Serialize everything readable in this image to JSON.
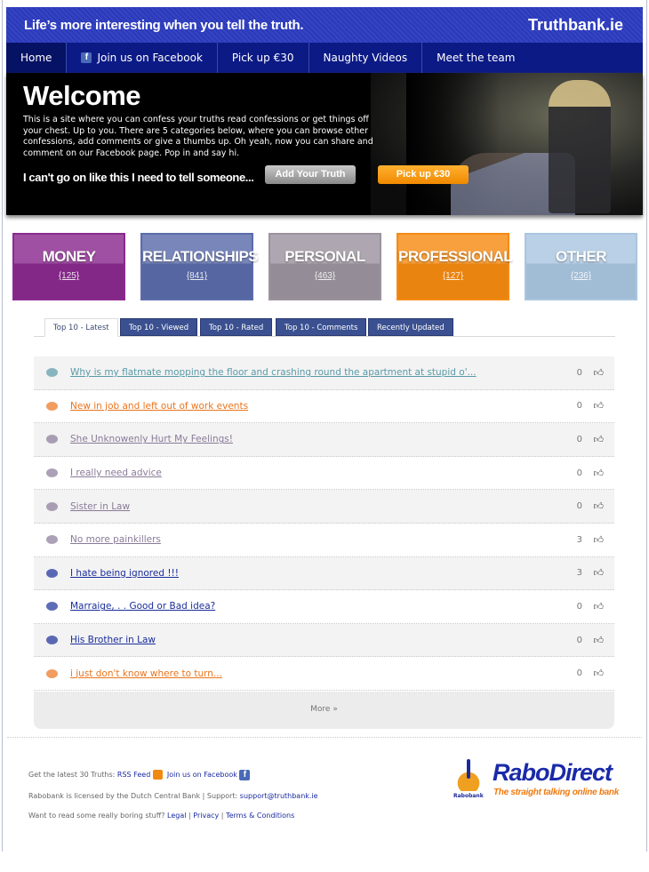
{
  "header": {
    "tagline": "Life’s more interesting when you tell the truth.",
    "brand": "Truthbank.ie"
  },
  "nav": {
    "items": [
      {
        "label": "Home"
      },
      {
        "label": "Join us on Facebook",
        "icon": "facebook-icon"
      },
      {
        "label": "Pick up €30"
      },
      {
        "label": "Naughty Videos"
      },
      {
        "label": "Meet the team"
      }
    ]
  },
  "hero": {
    "title": "Welcome",
    "text": "This is a site where you can confess your truths read confessions or get things off your chest. Up to you. There are 5 categories below, where you can browse other confessions, add comments or give a thumbs up. Oh yeah, now you can share and comment on our Facebook page. Pop in and say hi.",
    "cta": "I can't go on like this I need to tell someone...",
    "add_button": "Add Your Truth",
    "pick_button": "Pick up €30"
  },
  "categories": [
    {
      "name": "MONEY",
      "count": "{125}",
      "color": "#8a2a8e"
    },
    {
      "name": "RELATIONSHIPS",
      "count": "{841}",
      "color": "#5b6cab"
    },
    {
      "name": "PERSONAL",
      "count": "{463}",
      "color": "#9c939f"
    },
    {
      "name": "PROFESSIONAL",
      "count": "{127}",
      "color": "#f58b12"
    },
    {
      "name": "OTHER",
      "count": "{236}",
      "color": "#aac6e0"
    }
  ],
  "tabs": [
    {
      "label": "Top 10 - Latest",
      "active": true
    },
    {
      "label": "Top 10 - Viewed"
    },
    {
      "label": "Top 10 - Rated"
    },
    {
      "label": "Top 10 - Comments"
    },
    {
      "label": "Recently Updated"
    }
  ],
  "list": [
    {
      "title": "Why is my flatmate mopping the floor and crashing round the apartment at stupid o'...",
      "votes": "0",
      "color": "#5a9aa8"
    },
    {
      "title": "New in job and left out of work events",
      "votes": "0",
      "color": "#ea741c"
    },
    {
      "title": "She Unknowenly Hurt My Feelings!",
      "votes": "0",
      "color": "#8a7a98"
    },
    {
      "title": "I really need advice",
      "votes": "0",
      "color": "#8a7a98"
    },
    {
      "title": "Sister in Law",
      "votes": "0",
      "color": "#8a7a98"
    },
    {
      "title": "No more painkillers",
      "votes": "3",
      "color": "#8a7a98"
    },
    {
      "title": "I hate being ignored !!!",
      "votes": "3",
      "color": "#1a2e9a"
    },
    {
      "title": "Marraige, . . Good or Bad idea?",
      "votes": "0",
      "color": "#1a2e9a"
    },
    {
      "title": "His Brother in Law",
      "votes": "0",
      "color": "#1a2e9a"
    },
    {
      "title": "i just don't know where to turn...",
      "votes": "0",
      "color": "#ea741c"
    }
  ],
  "more": "More »",
  "footer": {
    "line1_text": "Get the latest 30 Truths:",
    "rss": "RSS Feed",
    "facebook": "Join us on Facebook",
    "line2_text": "Rabobank is licensed by the Dutch Central Bank | Support:",
    "support": "support@truthbank.ie",
    "line3_text": "Want to read some really boring stuff?",
    "legal": "Legal",
    "privacy": "Privacy",
    "terms": "Terms & Conditions",
    "sep": "|"
  },
  "sponsor": {
    "name": "RaboDirect",
    "slogan": "The straight talking online bank",
    "small": "Rabobank"
  }
}
